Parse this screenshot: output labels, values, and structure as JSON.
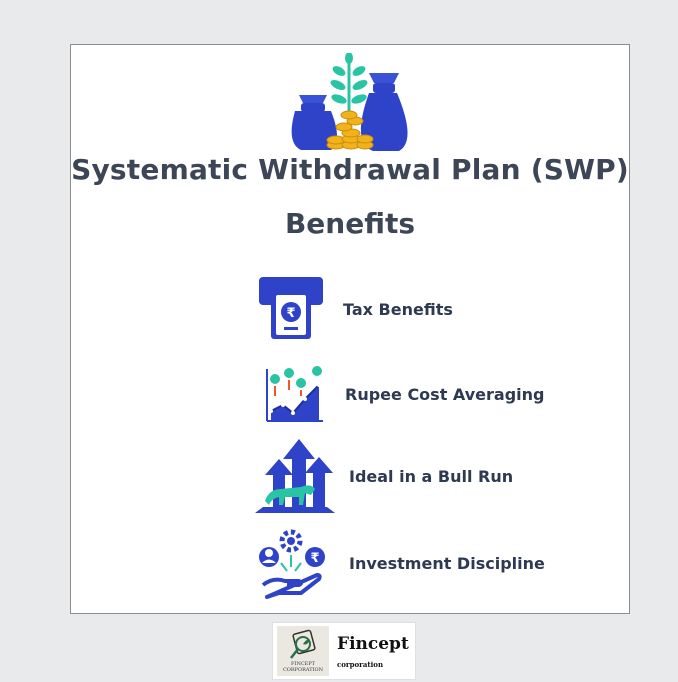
{
  "infographic": {
    "title": "Systematic Withdrawal Plan (SWP)",
    "subtitle": "Benefits",
    "benefits": [
      {
        "label": "Tax Benefits",
        "icon": "atm-rupee-icon"
      },
      {
        "label": "Rupee Cost Averaging",
        "icon": "rupee-cost-chart-icon"
      },
      {
        "label": "Ideal in a Bull Run",
        "icon": "bull-arrows-icon"
      },
      {
        "label": "Investment Discipline",
        "icon": "discipline-hand-icon"
      }
    ],
    "hero_icon": "money-bags-plant-icon",
    "colors": {
      "primary": "#2f43c8",
      "text": "#3d4657",
      "coin": "#f2b21b",
      "leaf": "#29c4a4"
    }
  },
  "logo": {
    "name": "Fincept",
    "sub": "corporation",
    "mark_text": "FINCEPT CORPORATION"
  }
}
